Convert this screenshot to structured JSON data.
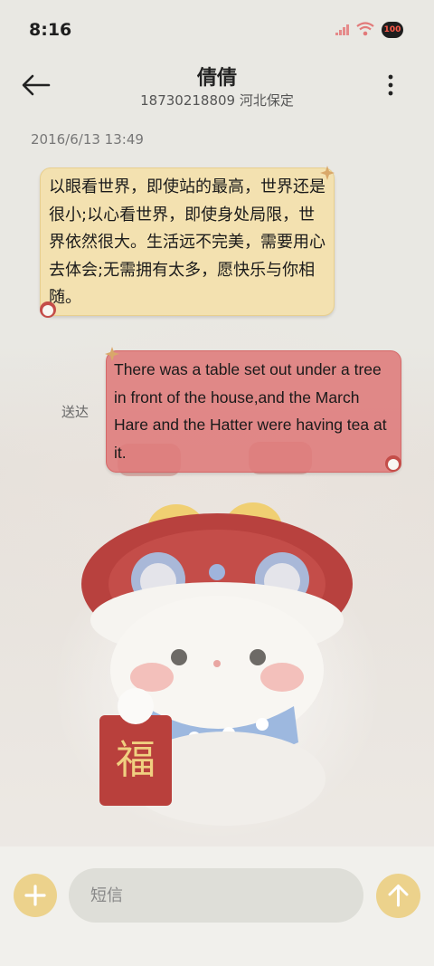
{
  "status_bar": {
    "time": "8:16",
    "battery": "100"
  },
  "header": {
    "contact_name": "倩倩",
    "contact_detail": "18730218809 河北保定"
  },
  "conversation": {
    "date": "2016/6/13 13:49",
    "incoming_message": "以眼看世界，即使站的最高，世界还是很小;以心看世界，即使身处局限，世界依然很大。生活远不完美，需要用心去体会;无需拥有太多，愿快乐与你相随。",
    "outgoing_message": "There was a table set out under a tree in front of the house,and the March Hare and the Hatter were having tea at it.",
    "delivery_status": "送达",
    "illustration_character": "福"
  },
  "composer": {
    "placeholder": "短信"
  },
  "colors": {
    "accent_yellow": "#ecd28c",
    "incoming_bubble": "#f3e1b0",
    "outgoing_bubble": "#de7878"
  },
  "icons": [
    "back-arrow-icon",
    "more-vert-icon",
    "signal-icon",
    "wifi-icon",
    "battery-icon",
    "plus-icon",
    "send-arrow-icon"
  ]
}
